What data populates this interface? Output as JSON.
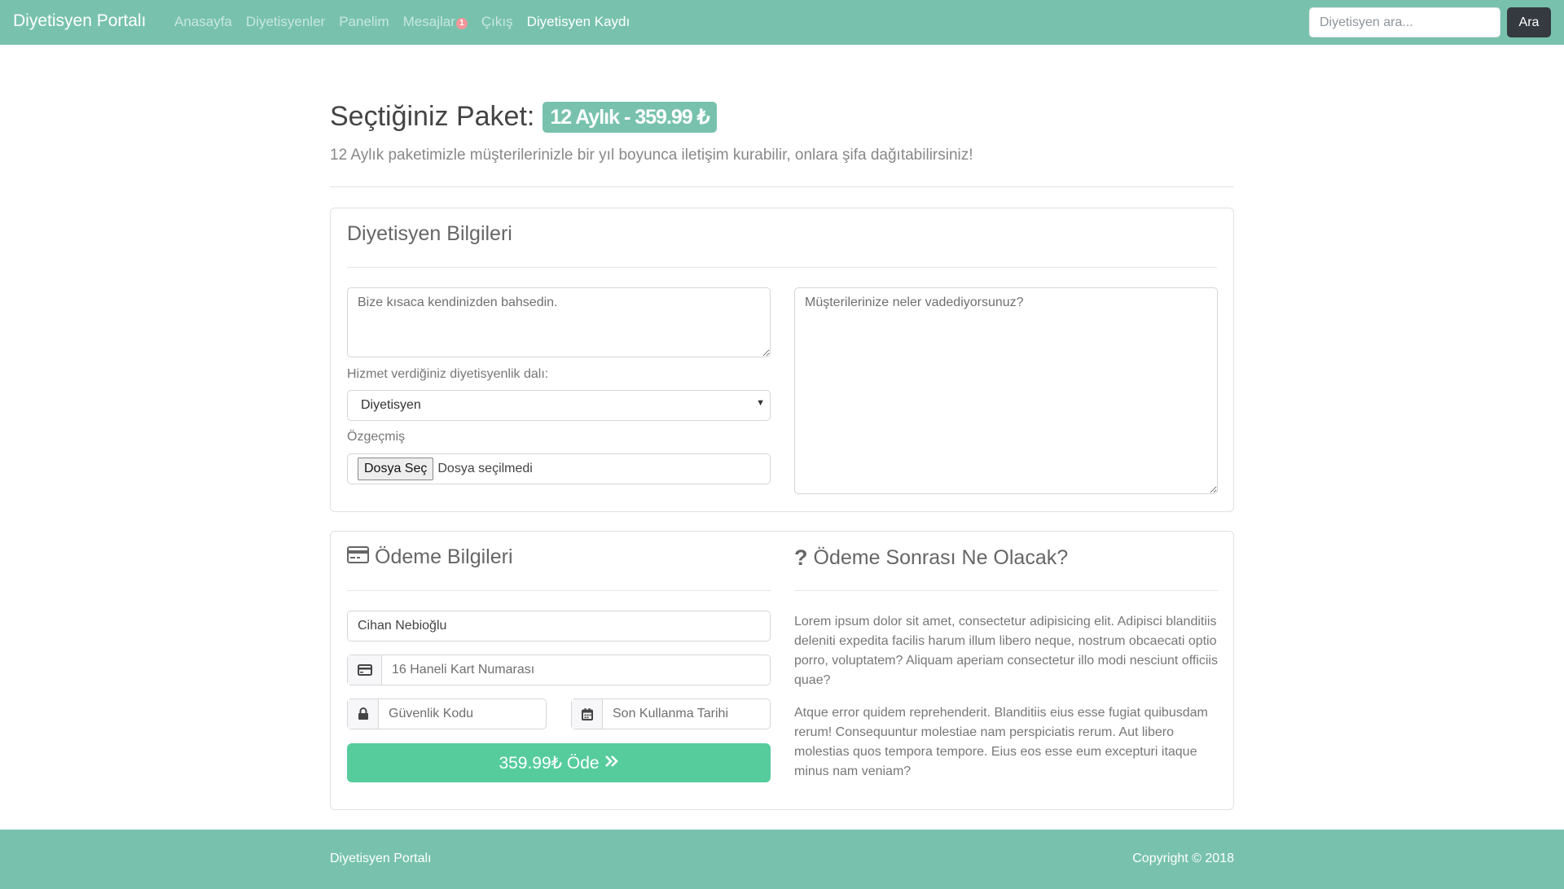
{
  "navbar": {
    "brand": "Diyetisyen Portalı",
    "links": [
      "Anasayfa",
      "Diyetisyenler",
      "Panelim",
      "Mesajlar",
      "Çıkış",
      "Diyetisyen Kaydı"
    ],
    "messages_badge": "1",
    "search_placeholder": "Diyetisyen ara...",
    "search_button": "Ara"
  },
  "header": {
    "title_prefix": "Seçtiğiniz Paket:",
    "package_badge": "12 Aylık - 359.99 ₺",
    "lead": "12 Aylık paketimizle müşterilerinizle bir yıl boyunca iletişim kurabilir, onlara şifa dağıtabilirsiniz!"
  },
  "dietitian_info": {
    "title": "Diyetisyen Bilgileri",
    "about_placeholder": "Bize kısaca kendinizden bahsedin.",
    "promise_placeholder": "Müşterilerinize neler vadediyorsunuz?",
    "branch_label": "Hizmet verdiğiniz diyetisyenlik dalı:",
    "branch_selected": "Diyetisyen",
    "cv_label": "Özgeçmiş",
    "file_button": "Dosya Seç",
    "file_status": "Dosya seçilmedi"
  },
  "payment": {
    "title": "Ödeme Bilgileri",
    "name_value": "Cihan Nebioğlu",
    "card_placeholder": "16 Haneli Kart Numarası",
    "cvv_placeholder": "Güvenlik Kodu",
    "expiry_placeholder": "Son Kullanma Tarihi",
    "pay_button": "359.99₺ Öde"
  },
  "after_payment": {
    "title": "Ödeme Sonrası Ne Olacak?",
    "paragraph1": "Lorem ipsum dolor sit amet, consectetur adipisicing elit. Adipisci blanditiis deleniti expedita facilis harum illum libero neque, nostrum obcaecati optio porro, voluptatem? Aliquam aperiam consectetur illo modi nesciunt officiis quae?",
    "paragraph2": "Atque error quidem reprehenderit. Blanditiis eius esse fugiat quibusdam rerum! Consequuntur molestiae nam perspiciatis rerum. Aut libero molestias quos tempora tempore. Eius eos esse eum excepturi itaque minus nam veniam?"
  },
  "footer": {
    "brand": "Diyetisyen Portalı",
    "copyright": "Copyright © 2018"
  },
  "icons": {
    "card_title_icon": "credit-card-icon",
    "question_icon": "question-icon",
    "card_addon_icon": "credit-card-icon",
    "lock_icon": "lock-icon",
    "calendar_icon": "calendar-icon",
    "pay_icon": "double-chevron-right-icon",
    "select_icon": "caret-down-icon"
  },
  "colors": {
    "navbar": "#78c2ad",
    "pay_button": "#56cc9d",
    "search_button": "#343a40",
    "badge": "#f3969a"
  }
}
